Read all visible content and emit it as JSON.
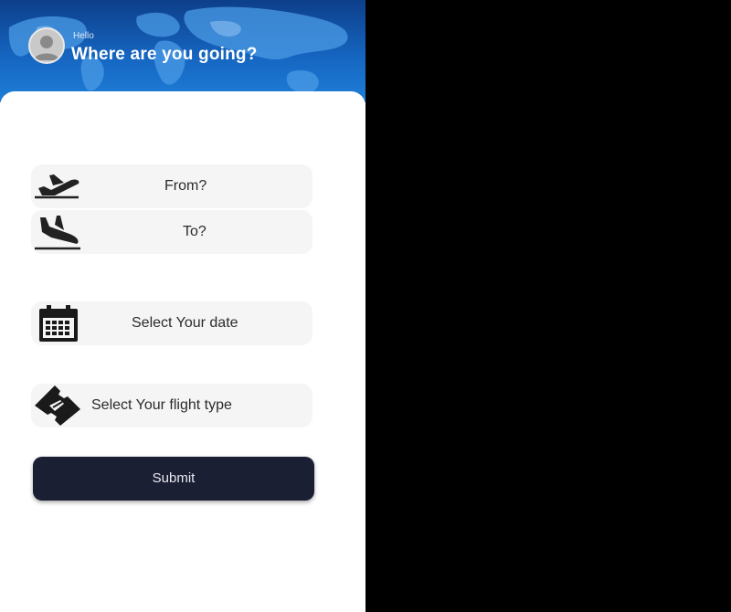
{
  "header": {
    "greeting": "Hello",
    "title": "Where are you going?"
  },
  "form": {
    "from_placeholder": "From?",
    "to_placeholder": "To?",
    "date_placeholder": "Select Your date",
    "flight_type_placeholder": "Select Your flight type",
    "submit_label": "Submit"
  },
  "icons": {
    "from": "airplane-takeoff-icon",
    "to": "airplane-landing-icon",
    "date": "calendar-icon",
    "flight_type": "ticket-icon",
    "avatar": "user-avatar-icon"
  },
  "colors": {
    "header": "#1565c0",
    "field_bg": "#f5f5f5",
    "submit_bg": "#1b1f33",
    "outside_bg": "#000000"
  }
}
